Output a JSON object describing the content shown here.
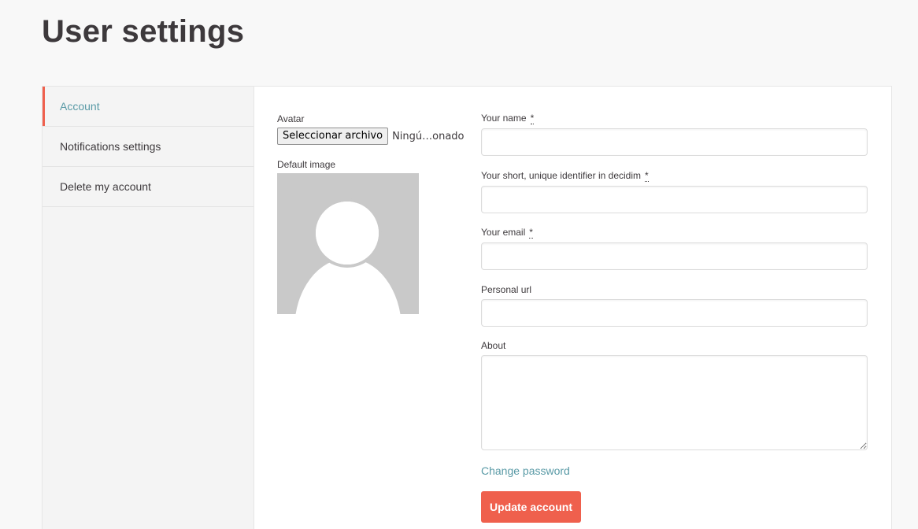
{
  "page": {
    "title": "User settings"
  },
  "sidebar": {
    "items": [
      {
        "label": "Account",
        "active": true
      },
      {
        "label": "Notifications settings",
        "active": false
      },
      {
        "label": "Delete my account",
        "active": false
      }
    ]
  },
  "avatar": {
    "label": "Avatar",
    "file_button": "Seleccionar archivo",
    "file_status": "Ningú…onado",
    "default_label": "Default image"
  },
  "form": {
    "name_label": "Your name",
    "nickname_label": "Your short, unique identifier in decidim",
    "email_label": "Your email",
    "url_label": "Personal url",
    "about_label": "About",
    "required_mark": "*",
    "name_value": "",
    "nickname_value": "",
    "email_value": "",
    "url_value": "",
    "about_value": ""
  },
  "actions": {
    "change_password": "Change password",
    "update_button": "Update account"
  },
  "colors": {
    "accent": "#ef604d",
    "link": "#599aa6",
    "avatar_bg": "#c9c9c9"
  }
}
